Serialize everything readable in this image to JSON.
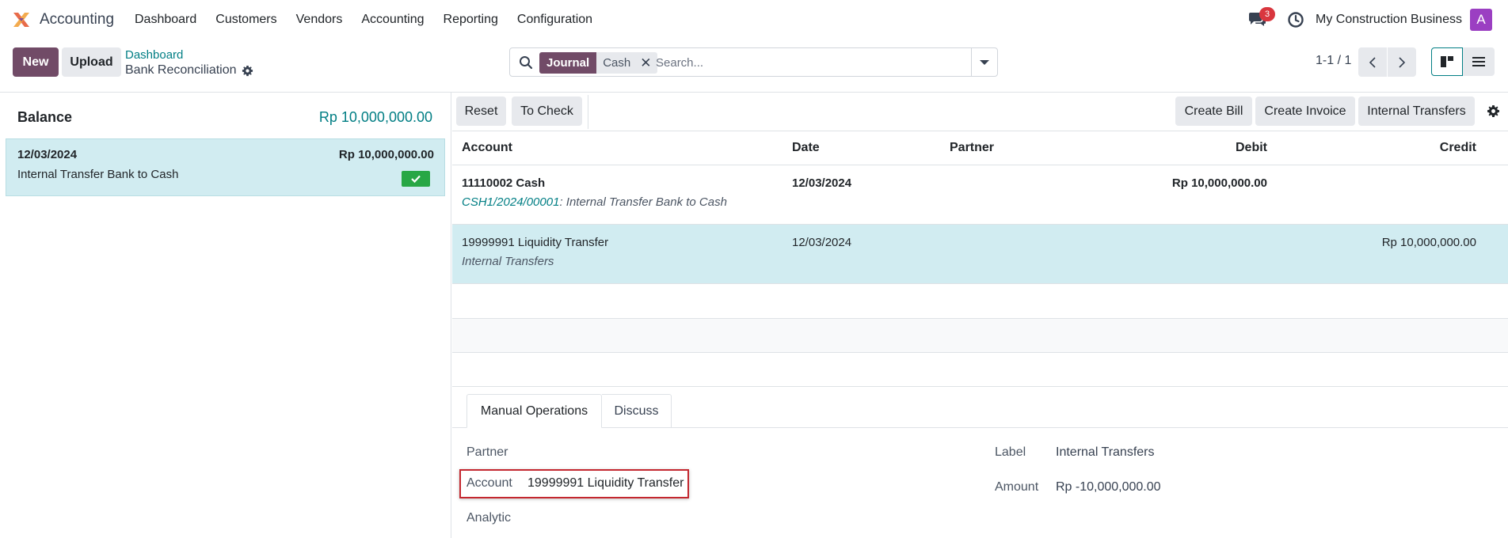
{
  "navbar": {
    "app_name": "Accounting",
    "menu": [
      "Dashboard",
      "Customers",
      "Vendors",
      "Accounting",
      "Reporting",
      "Configuration"
    ],
    "message_count": "3",
    "company": "My Construction Business",
    "avatar_letter": "A"
  },
  "control_panel": {
    "new_label": "New",
    "upload_label": "Upload",
    "breadcrumb_parent": "Dashboard",
    "breadcrumb_current": "Bank Reconciliation",
    "search": {
      "facet_label": "Journal",
      "facet_value": "Cash",
      "placeholder": "Search..."
    },
    "pager": "1-1 / 1"
  },
  "left_panel": {
    "balance_label": "Balance",
    "balance_amount": "Rp 10,000,000.00",
    "statement": {
      "date": "12/03/2024",
      "amount": "Rp 10,000,000.00",
      "label": "Internal Transfer Bank to Cash"
    }
  },
  "toolbar": {
    "reset": "Reset",
    "to_check": "To Check",
    "create_bill": "Create Bill",
    "create_invoice": "Create Invoice",
    "internal_transfers": "Internal Transfers"
  },
  "table": {
    "headers": {
      "account": "Account",
      "date": "Date",
      "partner": "Partner",
      "debit": "Debit",
      "credit": "Credit"
    },
    "rows": [
      {
        "account": "11110002 Cash",
        "ref": "CSH1/2024/00001",
        "sub": ": Internal Transfer Bank to Cash",
        "date": "12/03/2024",
        "partner": "",
        "debit": "Rp 10,000,000.00",
        "credit": ""
      },
      {
        "account": "19999991 Liquidity Transfer",
        "sub": "Internal Transfers",
        "date": "12/03/2024",
        "partner": "",
        "debit": "",
        "credit": "Rp 10,000,000.00"
      }
    ]
  },
  "notebook": {
    "tabs": [
      "Manual Operations",
      "Discuss"
    ],
    "active_tab": "Manual Operations",
    "fields": {
      "partner_label": "Partner",
      "account_label": "Account",
      "account_value": "19999991 Liquidity Transfer",
      "analytic_label": "Analytic",
      "label_label": "Label",
      "label_value": "Internal Transfers",
      "amount_label": "Amount",
      "amount_value": "Rp -10,000,000.00"
    }
  },
  "colors": {
    "brand": "#714b67",
    "accent": "#017e84",
    "selected_row": "#d1ecf1",
    "success": "#28a745",
    "highlight": "#c4272f"
  }
}
